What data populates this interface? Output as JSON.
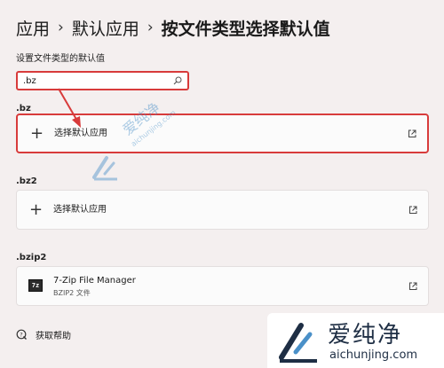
{
  "breadcrumb": {
    "items": [
      "应用",
      "默认应用"
    ],
    "current": "按文件类型选择默认值",
    "separator": "›"
  },
  "section_label": "设置文件类型的默认值",
  "search": {
    "value": ".bz"
  },
  "entries": [
    {
      "extension": ".bz",
      "action_label": "选择默认应用"
    },
    {
      "extension": ".bz2",
      "action_label": "选择默认应用"
    },
    {
      "extension": ".bzip2",
      "app_name": "7-Zip File Manager",
      "app_subtitle": "BZIP2 文件",
      "app_icon_text": "7z"
    }
  ],
  "help": {
    "label": "获取帮助"
  },
  "watermark": {
    "middle_text": "爱纯净",
    "middle_url": "aichunjing.com",
    "logo_text": "爱纯净",
    "logo_url": "aichunjing.com"
  },
  "colors": {
    "highlight": "#d83b3b",
    "background": "#f4efef",
    "card": "#fbfbfb",
    "watermark_blue": "#4a90c8"
  }
}
